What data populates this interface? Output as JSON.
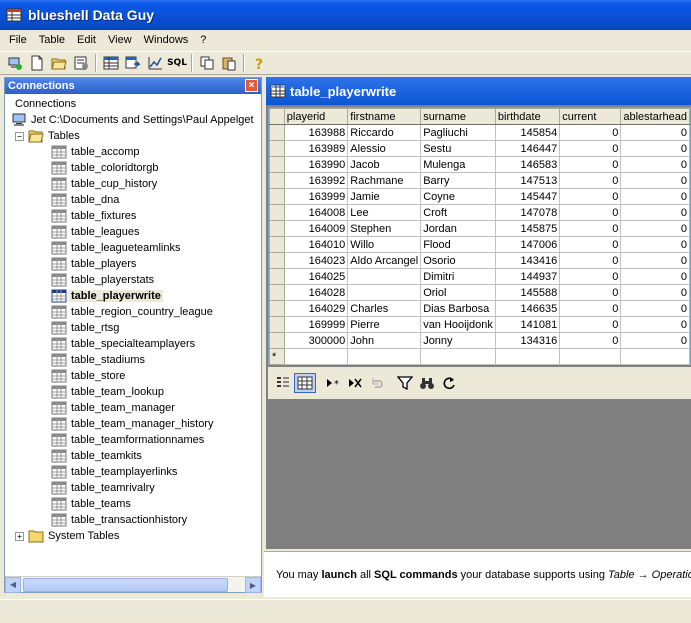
{
  "window": {
    "title": "blueshell Data Guy"
  },
  "menu": [
    "File",
    "Table",
    "Edit",
    "View",
    "Windows",
    "?"
  ],
  "toolbar": {
    "sql_label": "SQL"
  },
  "connections": {
    "title": "Connections",
    "close": "×",
    "root": "Connections",
    "db": "Jet  C:\\Documents and Settings\\Paul Appelget",
    "tables_folder": "Tables",
    "tables": [
      "table_accomp",
      "table_coloridtorgb",
      "table_cup_history",
      "table_dna",
      "table_fixtures",
      "table_leagues",
      "table_leagueteamlinks",
      "table_players",
      "table_playerstats",
      "table_playerwrite",
      "table_region_country_league",
      "table_rtsg",
      "table_specialteamplayers",
      "table_stadiums",
      "table_store",
      "table_team_lookup",
      "table_team_manager",
      "table_team_manager_history",
      "table_teamformationnames",
      "table_teamkits",
      "table_teamplayerlinks",
      "table_teamrivalry",
      "table_teams",
      "table_transactionhistory"
    ],
    "selected": "table_playerwrite",
    "system_folder": "System Tables"
  },
  "grid": {
    "title": "table_playerwrite",
    "columns": [
      "playerid",
      "firstname",
      "surname",
      "birthdate",
      "current",
      "ablestarhead"
    ],
    "rows": [
      [
        "163988",
        "Riccardo",
        "Pagliuchi",
        "145854",
        "0",
        "0"
      ],
      [
        "163989",
        "Alessio",
        "Sestu",
        "146447",
        "0",
        "0"
      ],
      [
        "163990",
        "Jacob",
        "Mulenga",
        "146583",
        "0",
        "0"
      ],
      [
        "163992",
        "Rachmane",
        "Barry",
        "147513",
        "0",
        "0"
      ],
      [
        "163999",
        "Jamie",
        "Coyne",
        "145447",
        "0",
        "0"
      ],
      [
        "164008",
        "Lee",
        "Croft",
        "147078",
        "0",
        "0"
      ],
      [
        "164009",
        "Stephen",
        "Jordan",
        "145875",
        "0",
        "0"
      ],
      [
        "164010",
        "Willo",
        "Flood",
        "147006",
        "0",
        "0"
      ],
      [
        "164023",
        "Aldo Arcangel",
        "Osorio",
        "143416",
        "0",
        "0"
      ],
      [
        "164025",
        "",
        "Dimitri",
        "144937",
        "0",
        "0"
      ],
      [
        "164028",
        "",
        "Oriol",
        "145588",
        "0",
        "0"
      ],
      [
        "164029",
        "Charles",
        "Dias Barbosa",
        "146635",
        "0",
        "0"
      ],
      [
        "169999",
        "Pierre",
        "van Hooijdonk",
        "141081",
        "0",
        "0"
      ],
      [
        "300000",
        "John",
        "Jonny",
        "134316",
        "0",
        "0"
      ]
    ],
    "new_row_marker": "*"
  },
  "hint": {
    "pre": "You may ",
    "b1": "launch",
    "mid1": " all ",
    "b2": "SQL commands",
    "mid2": " your database supports using ",
    "i1": "Table → Operation"
  }
}
